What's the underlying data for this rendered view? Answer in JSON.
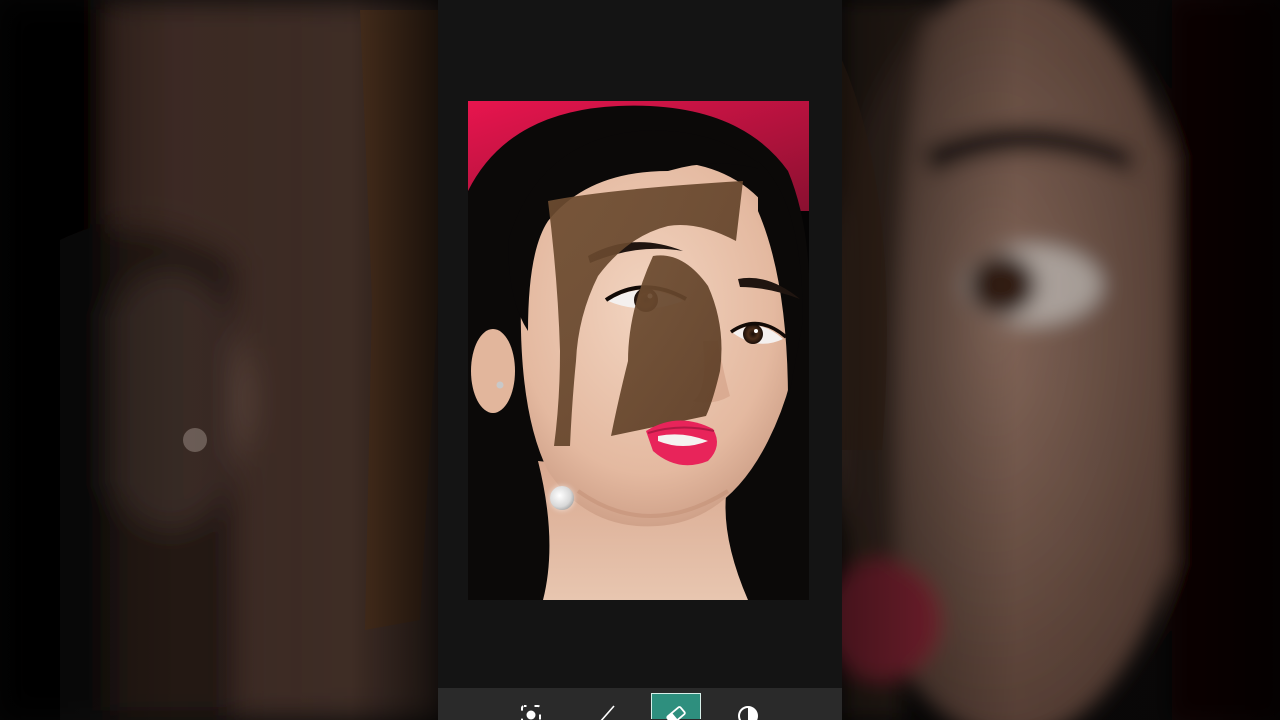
{
  "app": {
    "tools": [
      {
        "id": "select",
        "icon": "focus-select-icon",
        "active": false
      },
      {
        "id": "brush",
        "icon": "brush-icon",
        "active": false
      },
      {
        "id": "eraser",
        "icon": "eraser-icon",
        "active": true
      },
      {
        "id": "blend",
        "icon": "blend-mode-icon",
        "active": false
      }
    ]
  },
  "colors": {
    "accent": "#2e8f7e",
    "frame": "#141414",
    "toolbar": "#2a2a2a",
    "photo_background": "#e8154e",
    "overlay_brown": "#6b4a2e"
  }
}
